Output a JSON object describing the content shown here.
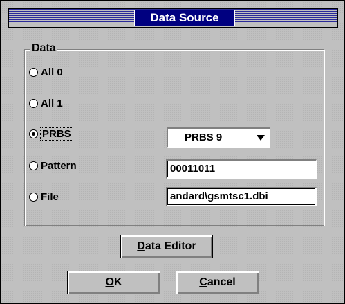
{
  "window": {
    "title": "Data Source"
  },
  "group": {
    "label": "Data"
  },
  "radios": [
    {
      "label": "All 0",
      "checked": false
    },
    {
      "label": "All 1",
      "checked": false
    },
    {
      "label": "PRBS",
      "checked": true
    },
    {
      "label": "Pattern",
      "checked": false
    },
    {
      "label": "File",
      "checked": false
    }
  ],
  "prbs_select": {
    "value": "PRBS 9"
  },
  "pattern_field": {
    "value": "00011011"
  },
  "file_field": {
    "value": "andard\\gsmtsc1.dbi"
  },
  "buttons": {
    "data_editor": {
      "mnemonic": "D",
      "rest": "ata Editor"
    },
    "ok": {
      "mnemonic": "O",
      "rest": "K"
    },
    "cancel": {
      "mnemonic": "C",
      "rest": "ancel"
    }
  }
}
